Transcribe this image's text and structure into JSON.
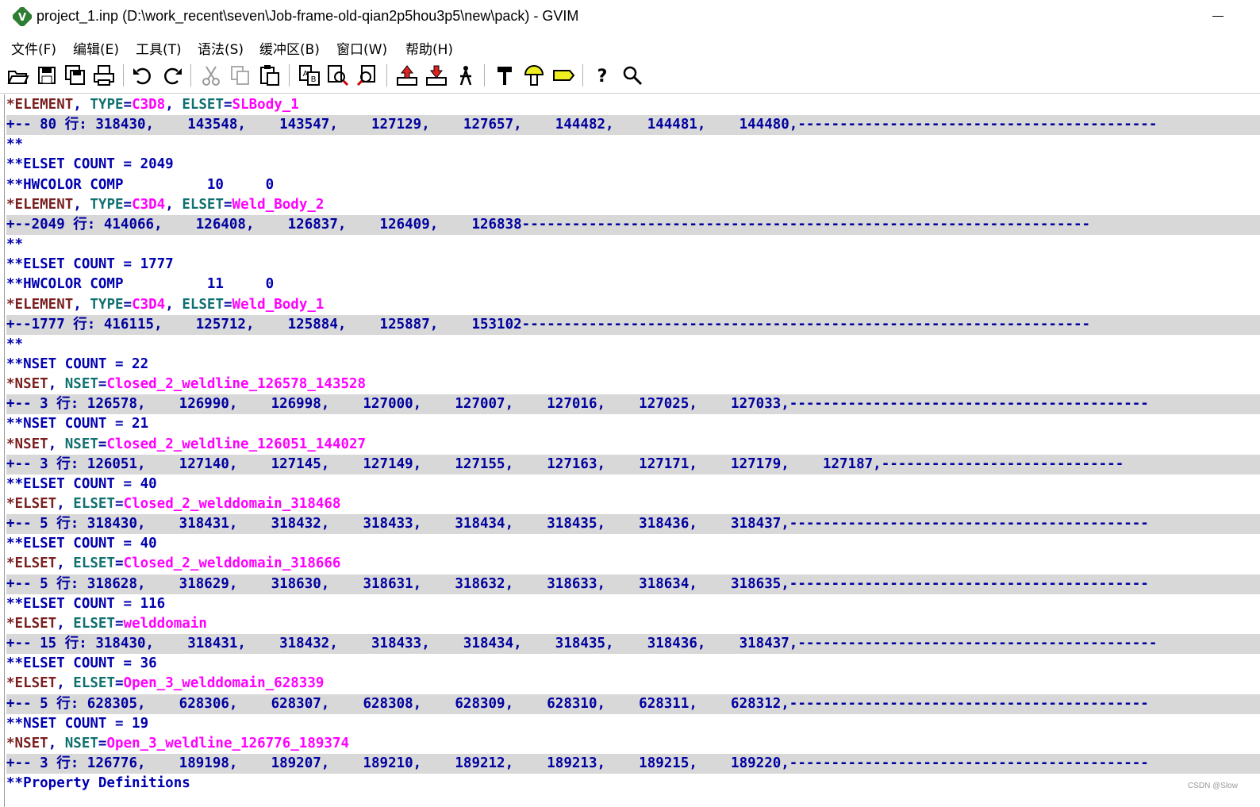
{
  "window": {
    "title": "project_1.inp (D:\\work_recent\\seven\\Job-frame-old-qian2p5hou3p5\\new\\pack) - GVIM"
  },
  "menu": [
    "文件(F)",
    "编辑(E)",
    "工具(T)",
    "语法(S)",
    "缓冲区(B)",
    "窗口(W)",
    "帮助(H)"
  ],
  "toolbar": {
    "icons": [
      "open-icon",
      "save-icon",
      "save-all-icon",
      "print-icon",
      "undo-icon",
      "redo-icon",
      "cut-icon",
      "copy-icon",
      "paste-icon",
      "replace-icon",
      "find-next-icon",
      "find-prev-icon",
      "load-session-icon",
      "save-session-icon",
      "run-script-icon",
      "make-icon",
      "shell-icon",
      "make-tags-icon",
      "help-icon",
      "find-help-icon"
    ]
  },
  "lines": [
    {
      "type": "decl",
      "kw": "*ELEMENT",
      "sep1": ", ",
      "k1": "TYPE",
      "v1": "C3D8",
      "sep2": ", ",
      "k2": "ELSET",
      "v2": "SLBody_1"
    },
    {
      "type": "fold",
      "text": "+-- 80 行: 318430,    143548,    143547,    127129,    127657,    144482,    144481,    144480,-------------------------------------------"
    },
    {
      "type": "comment",
      "text": "**"
    },
    {
      "type": "comment",
      "text": "**ELSET COUNT = 2049"
    },
    {
      "type": "comment",
      "text": "**HWCOLOR COMP          10     0"
    },
    {
      "type": "decl",
      "kw": "*ELEMENT",
      "sep1": ", ",
      "k1": "TYPE",
      "v1": "C3D4",
      "sep2": ", ",
      "k2": "ELSET",
      "v2": "Weld_Body_2"
    },
    {
      "type": "fold",
      "text": "+--2049 行: 414066,    126408,    126837,    126409,    126838--------------------------------------------------------------------"
    },
    {
      "type": "comment",
      "text": "**"
    },
    {
      "type": "comment",
      "text": "**ELSET COUNT = 1777"
    },
    {
      "type": "comment",
      "text": "**HWCOLOR COMP          11     0"
    },
    {
      "type": "decl",
      "kw": "*ELEMENT",
      "sep1": ", ",
      "k1": "TYPE",
      "v1": "C3D4",
      "sep2": ", ",
      "k2": "ELSET",
      "v2": "Weld_Body_1"
    },
    {
      "type": "fold",
      "text": "+--1777 行: 416115,    125712,    125884,    125887,    153102--------------------------------------------------------------------"
    },
    {
      "type": "comment",
      "text": "**"
    },
    {
      "type": "comment",
      "text": "**NSET COUNT = 22"
    },
    {
      "type": "decl",
      "kw": "*NSET",
      "sep1": ", ",
      "k1": "NSET",
      "v1": "Closed_2_weldline_126578_143528"
    },
    {
      "type": "fold",
      "text": "+-- 3 行: 126578,    126990,    126998,    127000,    127007,    127016,    127025,    127033,-------------------------------------------"
    },
    {
      "type": "comment",
      "text": "**NSET COUNT = 21"
    },
    {
      "type": "decl",
      "kw": "*NSET",
      "sep1": ", ",
      "k1": "NSET",
      "v1": "Closed_2_weldline_126051_144027"
    },
    {
      "type": "fold",
      "text": "+-- 3 行: 126051,    127140,    127145,    127149,    127155,    127163,    127171,    127179,    127187,-----------------------------"
    },
    {
      "type": "comment",
      "text": "**ELSET COUNT = 40"
    },
    {
      "type": "decl",
      "kw": "*ELSET",
      "sep1": ", ",
      "k1": "ELSET",
      "v1": "Closed_2_welddomain_318468"
    },
    {
      "type": "fold",
      "text": "+-- 5 行: 318430,    318431,    318432,    318433,    318434,    318435,    318436,    318437,-------------------------------------------"
    },
    {
      "type": "comment",
      "text": "**ELSET COUNT = 40"
    },
    {
      "type": "decl",
      "kw": "*ELSET",
      "sep1": ", ",
      "k1": "ELSET",
      "v1": "Closed_2_welddomain_318666"
    },
    {
      "type": "fold",
      "text": "+-- 5 行: 318628,    318629,    318630,    318631,    318632,    318633,    318634,    318635,-------------------------------------------"
    },
    {
      "type": "comment",
      "text": "**ELSET COUNT = 116"
    },
    {
      "type": "decl",
      "kw": "*ELSET",
      "sep1": ", ",
      "k1": "ELSET",
      "v1": "welddomain"
    },
    {
      "type": "fold",
      "text": "+-- 15 行: 318430,    318431,    318432,    318433,    318434,    318435,    318436,    318437,-------------------------------------------"
    },
    {
      "type": "comment",
      "text": "**ELSET COUNT = 36"
    },
    {
      "type": "decl",
      "kw": "*ELSET",
      "sep1": ", ",
      "k1": "ELSET",
      "v1": "Open_3_welddomain_628339"
    },
    {
      "type": "fold",
      "text": "+-- 5 行: 628305,    628306,    628307,    628308,    628309,    628310,    628311,    628312,-------------------------------------------"
    },
    {
      "type": "comment",
      "text": "**NSET COUNT = 19"
    },
    {
      "type": "decl",
      "kw": "*NSET",
      "sep1": ", ",
      "k1": "NSET",
      "v1": "Open_3_weldline_126776_189374"
    },
    {
      "type": "fold",
      "text": "+-- 3 行: 126776,    189198,    189207,    189210,    189212,    189213,    189215,    189220,-------------------------------------------"
    },
    {
      "type": "comment",
      "text": "**Property Definitions"
    }
  ],
  "watermark": "CSDN @Slow"
}
